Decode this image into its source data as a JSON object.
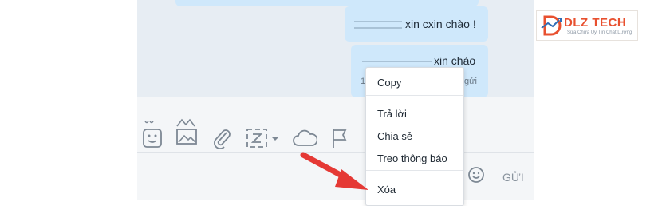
{
  "messages": [
    {
      "text": "xin cxin chào !"
    },
    {
      "text": "xin chào",
      "meta": "1",
      "status": "gửi"
    }
  ],
  "context_menu": {
    "items": [
      "Copy",
      "Trả lời",
      "Chia sẻ",
      "Treo thông báo",
      "Xóa"
    ]
  },
  "composer": {
    "send_label": "GỬI"
  },
  "toolbar_icons": [
    "sticker-icon",
    "image-icon",
    "paperclip-icon",
    "screenshot-icon",
    "cloud-icon",
    "flag-icon"
  ],
  "logo": {
    "name": "DLZ TECH",
    "tagline": "Sửa Chữa Uy Tín Chất Lượng"
  },
  "colors": {
    "chat_bg": "#e7edf3",
    "bubble": "#cfe8fb",
    "arrow": "#e53935",
    "logo_accent": "#e8502f"
  }
}
